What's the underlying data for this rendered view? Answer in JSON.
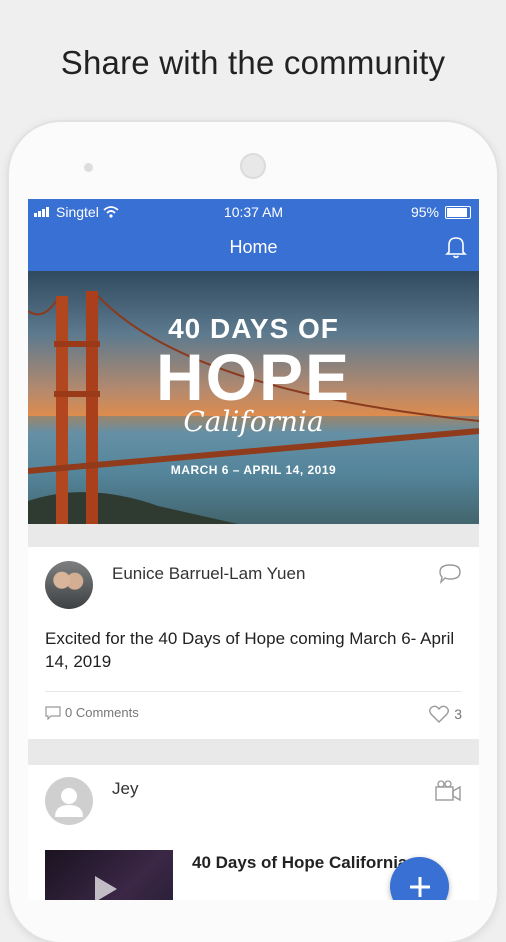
{
  "headline": "Share with the community",
  "status_bar": {
    "carrier": "Singtel",
    "time": "10:37 AM",
    "battery": "95%"
  },
  "nav": {
    "title": "Home"
  },
  "banner": {
    "line1": "40 DAYS OF",
    "line2": "HOPE",
    "script": "California",
    "dates": "MARCH 6 – APRIL 14, 2019"
  },
  "posts": [
    {
      "author": "Eunice Barruel-Lam Yuen",
      "text": "Excited for the 40 Days of Hope coming March 6- April 14, 2019",
      "comments": "0 Comments",
      "likes": "3"
    },
    {
      "author": "Jey",
      "video_title": "40 Days of Hope California"
    }
  ],
  "colors": {
    "brand": "#3870d4",
    "background": "#efefef"
  }
}
